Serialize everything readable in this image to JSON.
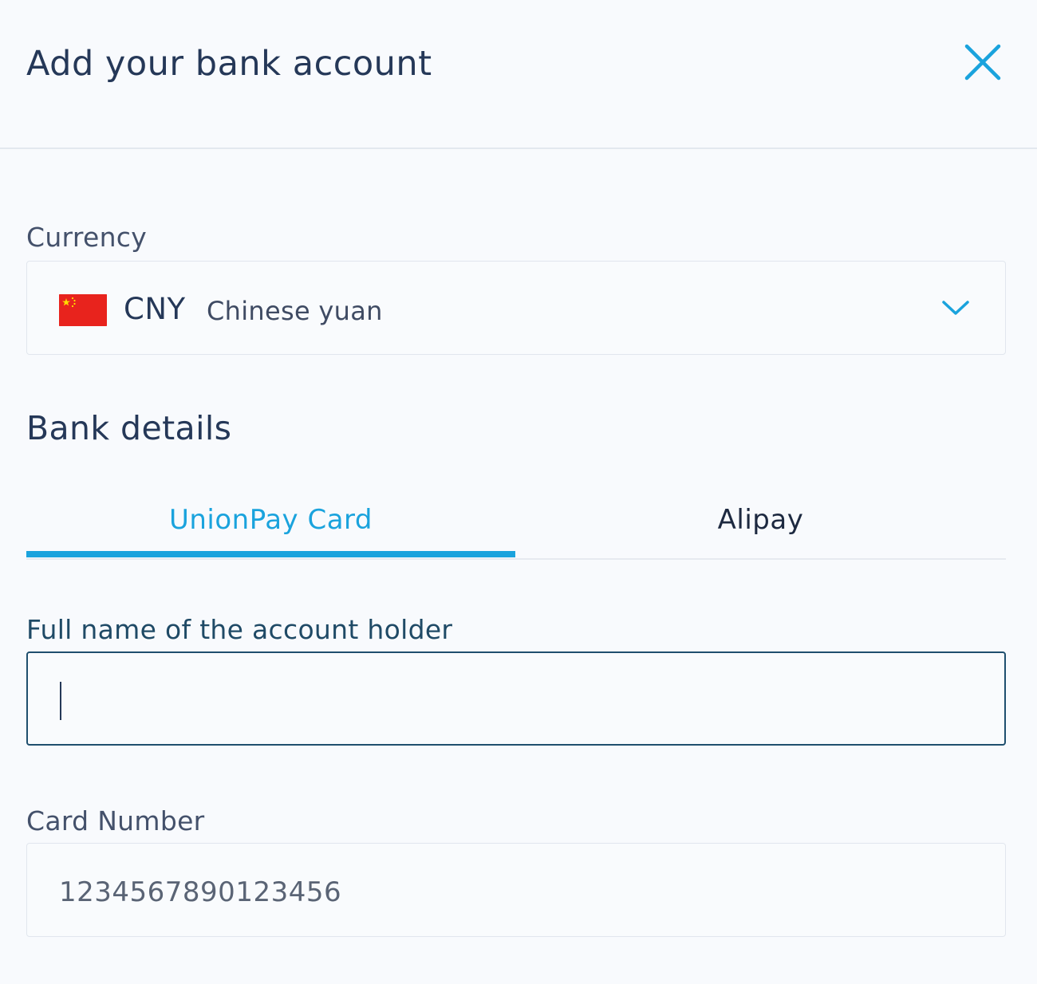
{
  "header": {
    "title": "Add your bank account",
    "close_icon": "close-icon"
  },
  "currency": {
    "label": "Currency",
    "code": "CNY",
    "name": "Chinese yuan",
    "flag_icon": "china-flag-icon",
    "dropdown_icon": "chevron-down-icon"
  },
  "bank_details": {
    "title": "Bank details",
    "tabs": [
      {
        "label": "UnionPay Card",
        "active": true
      },
      {
        "label": "Alipay",
        "active": false
      }
    ]
  },
  "form": {
    "holder_name": {
      "label": "Full name of the account holder",
      "value": ""
    },
    "card_number": {
      "label": "Card Number",
      "placeholder": "1234567890123456"
    }
  },
  "colors": {
    "accent": "#1aa3dd",
    "text_dark": "#253858",
    "flag_red": "#e8231d",
    "flag_yellow": "#ffde00"
  }
}
